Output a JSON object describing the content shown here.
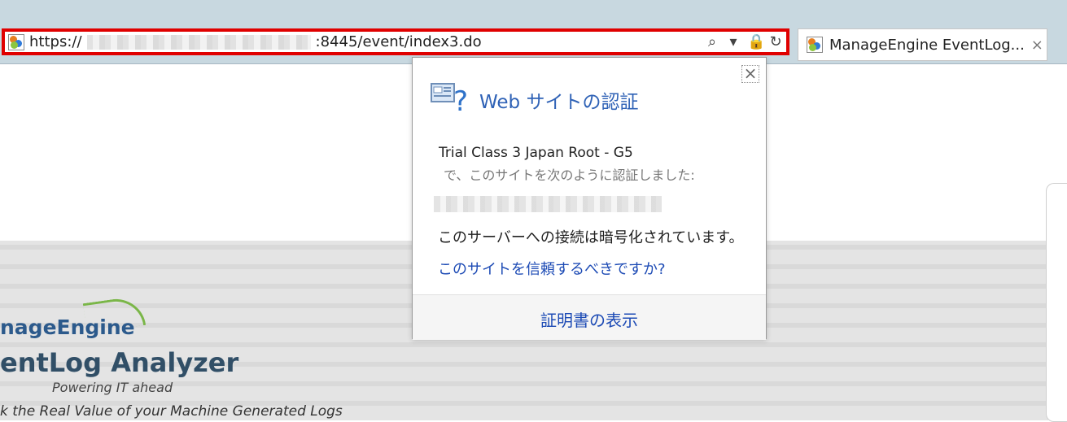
{
  "browser": {
    "address_bar": {
      "url_prefix": "https://",
      "url_suffix": ":8445/event/index3.do",
      "icons": [
        "search-icon",
        "dropdown-arrow-icon",
        "lock-icon",
        "refresh-icon"
      ]
    },
    "tab": {
      "title": "ManageEngine EventLog...",
      "close_label": "×"
    }
  },
  "background": {
    "logo_text": "nageEngine",
    "product_title": "entLog Analyzer",
    "tagline": "Powering IT ahead",
    "slogan": "k the Real Value of your Machine Generated Logs"
  },
  "popup": {
    "title": "Web サイトの認証",
    "issuer": "Trial Class 3 Japan Root - G5",
    "verification_text": "で、このサイトを次のように認証しました:",
    "encrypted_text": "このサーバーへの接続は暗号化されています。",
    "trust_link": "このサイトを信頼するべきですか?",
    "view_certificate": "証明書の表示",
    "close_label": "×"
  }
}
